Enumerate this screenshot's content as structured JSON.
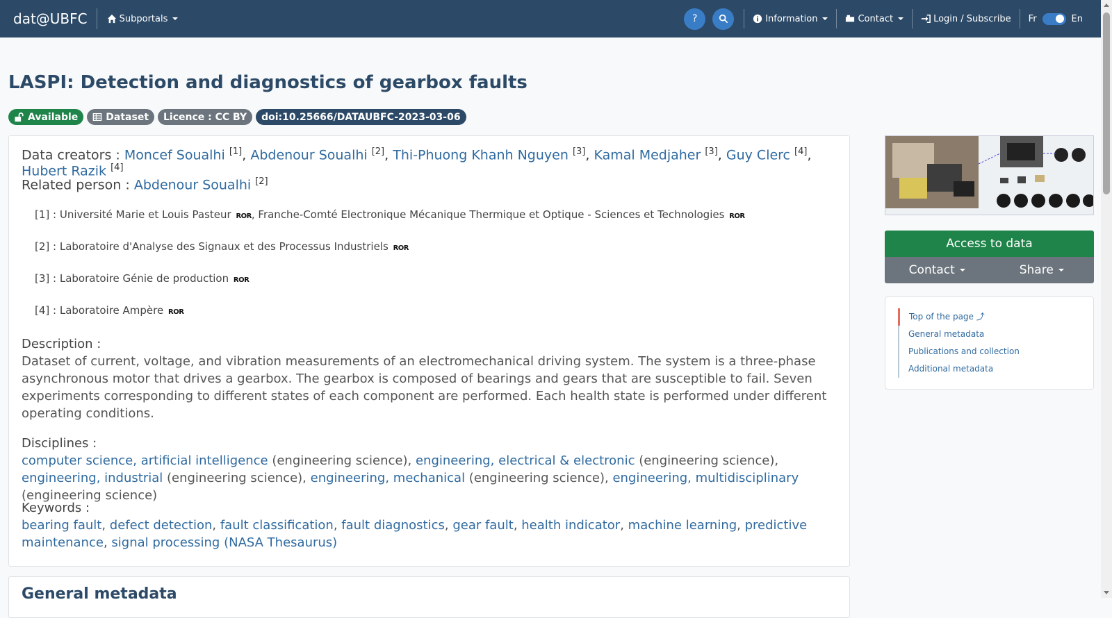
{
  "navbar": {
    "brand": "dat@UBFC",
    "subportals": "Subportals",
    "information": "Information",
    "contact": "Contact",
    "login": "Login / Subscribe",
    "lang_fr": "Fr",
    "lang_en": "En",
    "help_glyph": "?"
  },
  "page": {
    "title": "LASPI: Detection and diagnostics of gearbox faults",
    "badges": {
      "available": "Available",
      "dataset": "Dataset",
      "licence": "Licence : CC BY",
      "doi": "doi:10.25666/DATAUBFC-2023-03-06"
    }
  },
  "creators": {
    "label": "Data creators :",
    "people": [
      {
        "name": "Moncef Soualhi",
        "ref": "[1]"
      },
      {
        "name": "Abdenour Soualhi",
        "ref": "[2]"
      },
      {
        "name": "Thi-Phuong Khanh Nguyen",
        "ref": "[3]"
      },
      {
        "name": "Kamal Medjaher",
        "ref": "[3]"
      },
      {
        "name": "Guy Clerc",
        "ref": "[4]"
      },
      {
        "name": "Hubert Razik",
        "ref": "[4]"
      }
    ],
    "separator": ","
  },
  "related": {
    "label": "Related person :",
    "name": "Abdenour Soualhi",
    "ref": "[2]"
  },
  "affiliations": [
    {
      "ref": "[1] :",
      "text": "Université Marie et Louis Pasteur",
      "text2": ", Franche-Comté Electronique Mécanique Thermique et Optique - Sciences et Technologies"
    },
    {
      "ref": "[2] :",
      "text": "Laboratoire d'Analyse des Signaux et des Processus Industriels"
    },
    {
      "ref": "[3] :",
      "text": "Laboratoire Génie de production"
    },
    {
      "ref": "[4] :",
      "text": "Laboratoire Ampère"
    }
  ],
  "ror_label": "ROR",
  "description": {
    "label": "Description :",
    "text": "Dataset of current, voltage, and vibration measurements of an electromechanical driving system. The system is a three-phase asynchronous motor that drives a gearbox. The gearbox is composed of bearings and gears that are susceptible to fail. Seven experiments corresponding to different states of each component are performed. Each health state is performed under different operating conditions."
  },
  "disciplines": {
    "label": "Disciplines :",
    "items": [
      {
        "name": "computer science, artificial intelligence",
        "scope": " (engineering science), "
      },
      {
        "name": "engineering, electrical & electronic",
        "scope": " (engineering science), "
      },
      {
        "name": "engineering, industrial",
        "scope": " (engineering science), "
      },
      {
        "name": "engineering, mechanical",
        "scope": " (engineering science), "
      },
      {
        "name": "engineering, multidisciplinary",
        "scope": " (engineering science)"
      }
    ]
  },
  "keywords": {
    "label": "Keywords :",
    "items": [
      "bearing fault",
      "defect detection",
      "fault classification",
      "fault diagnostics",
      "gear fault",
      "health indicator",
      "machine learning",
      "predictive maintenance",
      "signal processing (NASA Thesaurus)"
    ]
  },
  "next_section": "General metadata",
  "sidebar": {
    "access": "Access to data",
    "contact": "Contact",
    "share": "Share",
    "toc": [
      "Top of the page",
      "General metadata",
      "Publications and collection",
      "Additional metadata"
    ],
    "toc_top_glyph": "⤴"
  },
  "colors": {
    "navbar": "#2c4a67",
    "available": "#1e8449",
    "link": "#2f6aa0",
    "active_marker": "#e46b5e"
  }
}
